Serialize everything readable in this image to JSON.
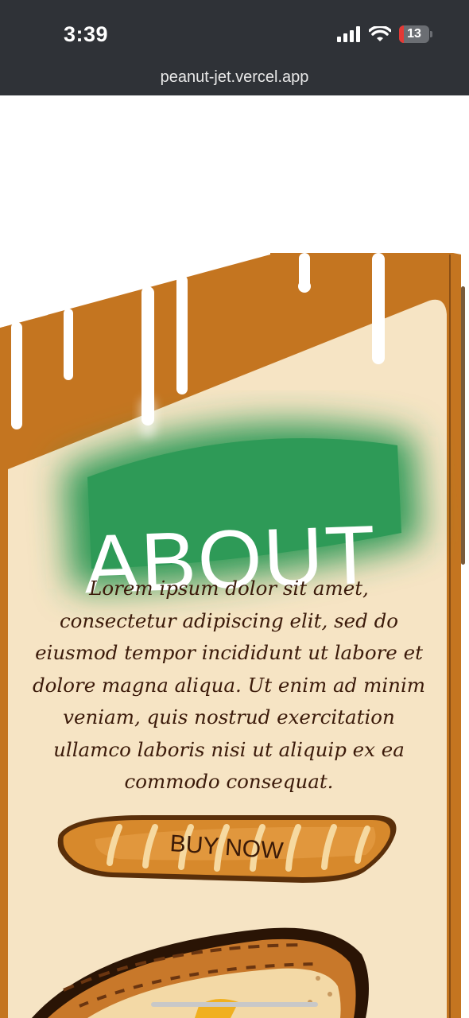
{
  "status_bar": {
    "time": "3:39",
    "battery_level": "13",
    "icons": [
      "cellular-signal-icon",
      "wifi-icon",
      "battery-icon"
    ]
  },
  "browser": {
    "url": "peanut-jet.vercel.app"
  },
  "about": {
    "title": "ABOUT",
    "body": "Lorem ipsum dolor sit amet, consectetur adipiscing elit, sed do eiusmod tempor incididunt ut labore et dolore magna aliqua. Ut enim ad minim veniam, quis nostrud exercitation ullamco laboris nisi ut aliquip ex ea commodo consequat.",
    "button_label": "BUY NOW"
  },
  "colors": {
    "status_bar": "#2f3237",
    "crust": "#c97a22",
    "bread": "#f6e4c4",
    "title_glow": "#2e9a57",
    "text": "#3b1a0a",
    "drip": "#ffffff"
  }
}
